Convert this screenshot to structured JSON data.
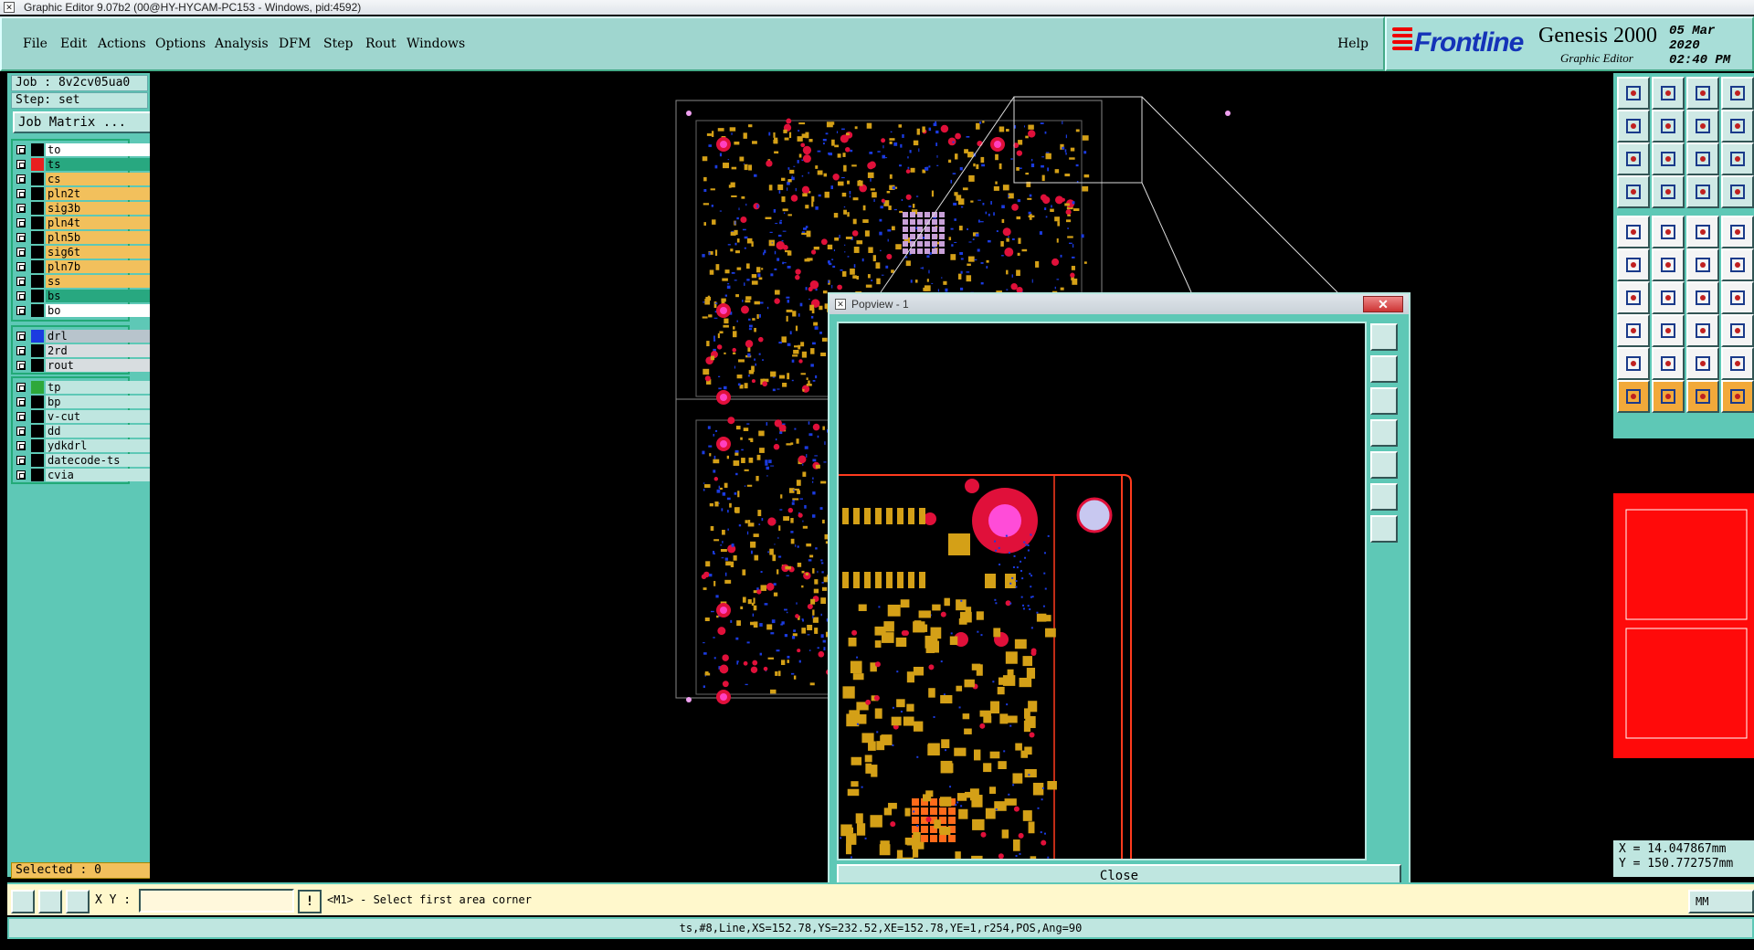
{
  "window": {
    "title": "Graphic Editor 9.07b2 (00@HY-HYCAM-PC153 - Windows, pid:4592)"
  },
  "menu": {
    "items": [
      "File",
      "Edit",
      "Actions",
      "Options",
      "Analysis",
      "DFM",
      "Step",
      "Rout",
      "Windows"
    ],
    "help": "Help"
  },
  "brand": {
    "logo": "Frontline",
    "product": "Genesis 2000",
    "subtitle": "Graphic Editor",
    "date": "05 Mar 2020",
    "time": "02:40 PM"
  },
  "job": {
    "job_label": "Job : 8v2cv05ua0",
    "step_label": "Step: set",
    "matrix_button": "Job Matrix ..."
  },
  "layers": {
    "group1": [
      {
        "name": "to",
        "swatch": "#000000",
        "bg": "#ffffff"
      },
      {
        "name": "ts",
        "swatch": "#e82020",
        "bg": "#28a880",
        "active": true
      },
      {
        "name": "cs",
        "swatch": "#000000",
        "bg": "#f2c05c"
      },
      {
        "name": "pln2t",
        "swatch": "#000000",
        "bg": "#f2c05c"
      },
      {
        "name": "sig3b",
        "swatch": "#000000",
        "bg": "#f2c05c"
      },
      {
        "name": "pln4t",
        "swatch": "#000000",
        "bg": "#f2c05c"
      },
      {
        "name": "pln5b",
        "swatch": "#000000",
        "bg": "#f2c05c"
      },
      {
        "name": "sig6t",
        "swatch": "#000000",
        "bg": "#f2c05c"
      },
      {
        "name": "pln7b",
        "swatch": "#000000",
        "bg": "#f2c05c"
      },
      {
        "name": "ss",
        "swatch": "#000000",
        "bg": "#f2c05c"
      },
      {
        "name": "bs",
        "swatch": "#000000",
        "bg": "#28a880"
      },
      {
        "name": "bo",
        "swatch": "#000000",
        "bg": "#ffffff"
      }
    ],
    "group2": [
      {
        "name": "drl",
        "swatch": "#1b3be0",
        "bg": "#b8c4cc"
      },
      {
        "name": "2rd",
        "swatch": "#000000",
        "bg": "#d8dde0"
      },
      {
        "name": "rout",
        "swatch": "#000000",
        "bg": "#d8dde0"
      }
    ],
    "group3": [
      {
        "name": "tp",
        "swatch": "#2ea83a",
        "bg": "#bfe6e0"
      },
      {
        "name": "bp",
        "swatch": "#000000",
        "bg": "#bfe6e0"
      },
      {
        "name": "v-cut",
        "swatch": "#000000",
        "bg": "#bfe6e0"
      },
      {
        "name": "dd",
        "swatch": "#000000",
        "bg": "#bfe6e0"
      },
      {
        "name": "ydkdrl",
        "swatch": "#000000",
        "bg": "#bfe6e0"
      },
      {
        "name": "datecode-ts",
        "swatch": "#000000",
        "bg": "#bfe6e0"
      },
      {
        "name": "cvia",
        "swatch": "#000000",
        "bg": "#bfe6e0"
      }
    ],
    "selected_label": "Selected : 0"
  },
  "popview": {
    "title": "Popview - 1",
    "close_x": "✕",
    "close_button": "Close"
  },
  "coords": {
    "x": "X = 14.047867mm",
    "y": "Y = 150.772757mm"
  },
  "command": {
    "xy_label": "X Y :",
    "xy_value": "",
    "excl": "!",
    "prompt": "<M1> - Select first area corner",
    "units": "MM"
  },
  "status": {
    "text": "ts,#8,Line,XS=152.78,YS=232.52,XE=152.78,YE=1,r254,POS,Ang=90"
  },
  "colors": {
    "panel": "#5ec8b6",
    "pad_red": "#e0103a",
    "copper": "#d4a017",
    "trace_blue": "#1b3be0",
    "outline": "#ff3b1e"
  }
}
